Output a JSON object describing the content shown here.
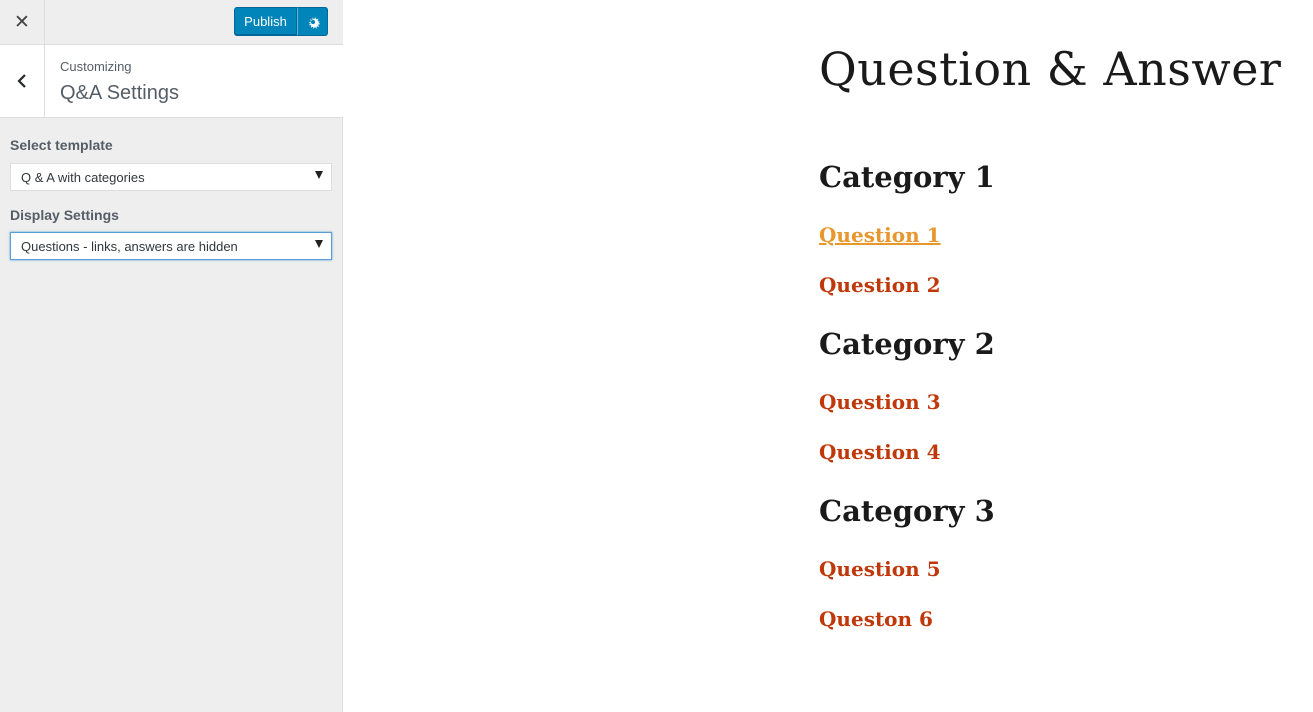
{
  "topbar": {
    "close_icon": "close-icon",
    "publish_label": "Publish",
    "settings_icon": "gear-icon",
    "accent_color": "#0085ba"
  },
  "section": {
    "breadcrumb": "Customizing",
    "title": "Q&A Settings",
    "back_icon": "chevron-left-icon"
  },
  "controls": {
    "template_label": "Select template",
    "template_value": "Q & A with categories",
    "display_label": "Display Settings",
    "display_value": "Questions - links, answers are hidden"
  },
  "preview": {
    "page_title": "Question & Answer",
    "categories": [
      {
        "title": "Category 1",
        "questions": [
          "Question 1",
          "Question 2"
        ]
      },
      {
        "title": "Category 2",
        "questions": [
          "Question 3",
          "Question 4"
        ]
      },
      {
        "title": "Category 3",
        "questions": [
          "Question 5",
          "Queston 6"
        ]
      }
    ],
    "link_color": "#c0380a",
    "link_hover_color": "#e8972c"
  }
}
